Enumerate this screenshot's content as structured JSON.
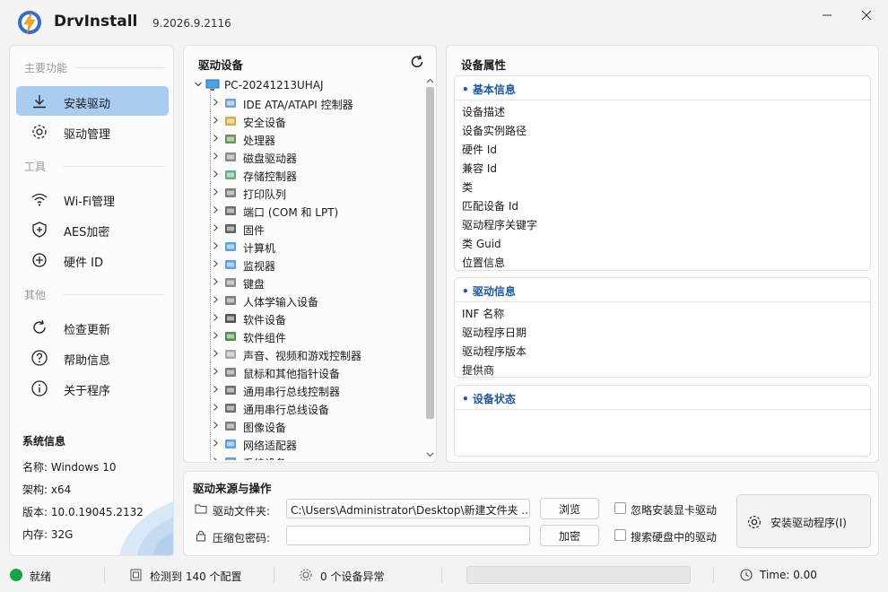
{
  "app": {
    "title": "DrvInstall",
    "version": "9.2026.9.2116"
  },
  "sidebar": {
    "section_main": "主要功能",
    "section_tools": "工具",
    "section_other": "其他",
    "items": [
      {
        "label": "安装驱动",
        "icon": "download-icon",
        "active": true
      },
      {
        "label": "驱动管理",
        "icon": "gear-icon"
      },
      {
        "label": "Wi-Fi管理",
        "icon": "wifi-icon"
      },
      {
        "label": "AES加密",
        "icon": "shield-icon"
      },
      {
        "label": "硬件 ID",
        "icon": "hardware-id-icon"
      },
      {
        "label": "检查更新",
        "icon": "refresh-icon"
      },
      {
        "label": "帮助信息",
        "icon": "help-icon"
      },
      {
        "label": "关于程序",
        "icon": "info-icon"
      }
    ],
    "system_info": {
      "title": "系统信息",
      "name": "名称: Windows 10",
      "arch": "架构: x64",
      "version": "版本: 10.0.19045.2132",
      "memory": "内存: 32G"
    }
  },
  "devices": {
    "title": "驱动设备",
    "root": "PC-20241213UHAJ",
    "categories": [
      {
        "label": "IDE ATA/ATAPI 控制器",
        "icon": "ide-controller-icon"
      },
      {
        "label": "安全设备",
        "icon": "security-device-icon"
      },
      {
        "label": "处理器",
        "icon": "processor-icon"
      },
      {
        "label": "磁盘驱动器",
        "icon": "disk-drive-icon"
      },
      {
        "label": "存储控制器",
        "icon": "storage-controller-icon"
      },
      {
        "label": "打印队列",
        "icon": "printer-icon"
      },
      {
        "label": "端口 (COM 和 LPT)",
        "icon": "port-icon"
      },
      {
        "label": "固件",
        "icon": "firmware-icon"
      },
      {
        "label": "计算机",
        "icon": "computer-icon"
      },
      {
        "label": "监视器",
        "icon": "monitor-icon"
      },
      {
        "label": "键盘",
        "icon": "keyboard-icon"
      },
      {
        "label": "人体学输入设备",
        "icon": "hid-icon"
      },
      {
        "label": "软件设备",
        "icon": "software-device-icon"
      },
      {
        "label": "软件组件",
        "icon": "software-component-icon"
      },
      {
        "label": "声音、视频和游戏控制器",
        "icon": "sound-icon"
      },
      {
        "label": "鼠标和其他指针设备",
        "icon": "mouse-icon"
      },
      {
        "label": "通用串行总线控制器",
        "icon": "usb-controller-icon"
      },
      {
        "label": "通用串行总线设备",
        "icon": "usb-device-icon"
      },
      {
        "label": "图像设备",
        "icon": "camera-icon"
      },
      {
        "label": "网络适配器",
        "icon": "network-adapter-icon"
      },
      {
        "label": "系统设备",
        "icon": "system-device-icon"
      }
    ]
  },
  "properties": {
    "title": "设备属性",
    "basic": {
      "title": "• 基本信息",
      "items": [
        "设备描述",
        "设备实例路径",
        "硬件 Id",
        "兼容 Id",
        "类",
        "匹配设备 Id",
        "驱动程序关键字",
        "类 Guid",
        "位置信息"
      ]
    },
    "driver": {
      "title": "• 驱动信息",
      "items": [
        "INF 名称",
        "驱动程序日期",
        "驱动程序版本",
        "提供商"
      ]
    },
    "status": {
      "title": "• 设备状态"
    }
  },
  "source": {
    "title": "驱动来源与操作",
    "folder_label": "驱动文件夹:",
    "folder_value": "C:\\Users\\Administrator\\Desktop\\新建文件夹 ...",
    "password_label": "压缩包密码:",
    "password_value": "",
    "browse_label": "浏览",
    "decrypt_label": "加密",
    "skip_gpu_label": "忽略安装显卡驱动",
    "search_disk_label": "搜索硬盘中的驱动",
    "skip_gpu_checked": false,
    "search_disk_checked": false,
    "install_label": "安装驱动程序(I)"
  },
  "status": {
    "ready": "就绪",
    "detected": "检测到 140 个配置",
    "abnormal": "0 个设备异常",
    "progress": 0,
    "time": "Time: 0.00",
    "accent_color": "#1aa34a"
  }
}
